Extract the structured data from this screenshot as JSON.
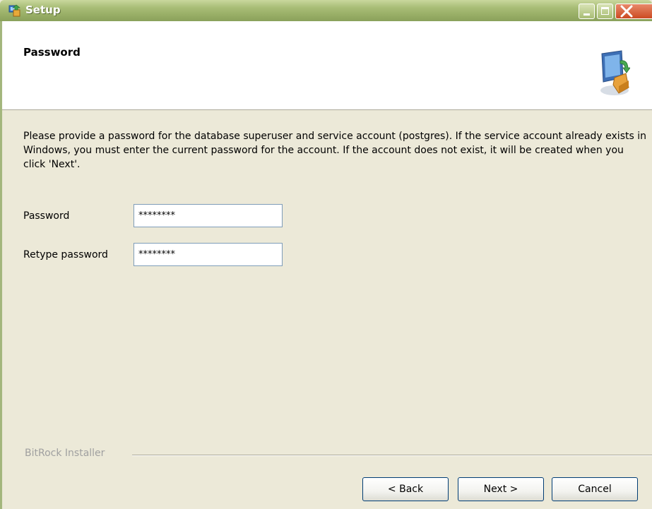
{
  "window": {
    "title": "Setup",
    "icon": "setup-icon",
    "controls": [
      "minimize-icon",
      "maximize-icon",
      "close-icon"
    ]
  },
  "header": {
    "title": "Password",
    "icon": "computer-package-icon"
  },
  "content": {
    "description": "Please provide a password for the database superuser and service account (postgres). If the service account already exists in Windows, you must enter the current password for the account. If the account does not exist, it will be created when you click 'Next'.",
    "password_label": "Password",
    "password_value": "********",
    "retype_label": "Retype password",
    "retype_value": "********"
  },
  "footer": {
    "brand": "BitRock Installer",
    "back_label": "< Back",
    "next_label": "Next >",
    "cancel_label": "Cancel"
  },
  "colors": {
    "titlebar": "#98ae66",
    "background": "#ECE9D8",
    "close_button": "#cc4a22"
  }
}
